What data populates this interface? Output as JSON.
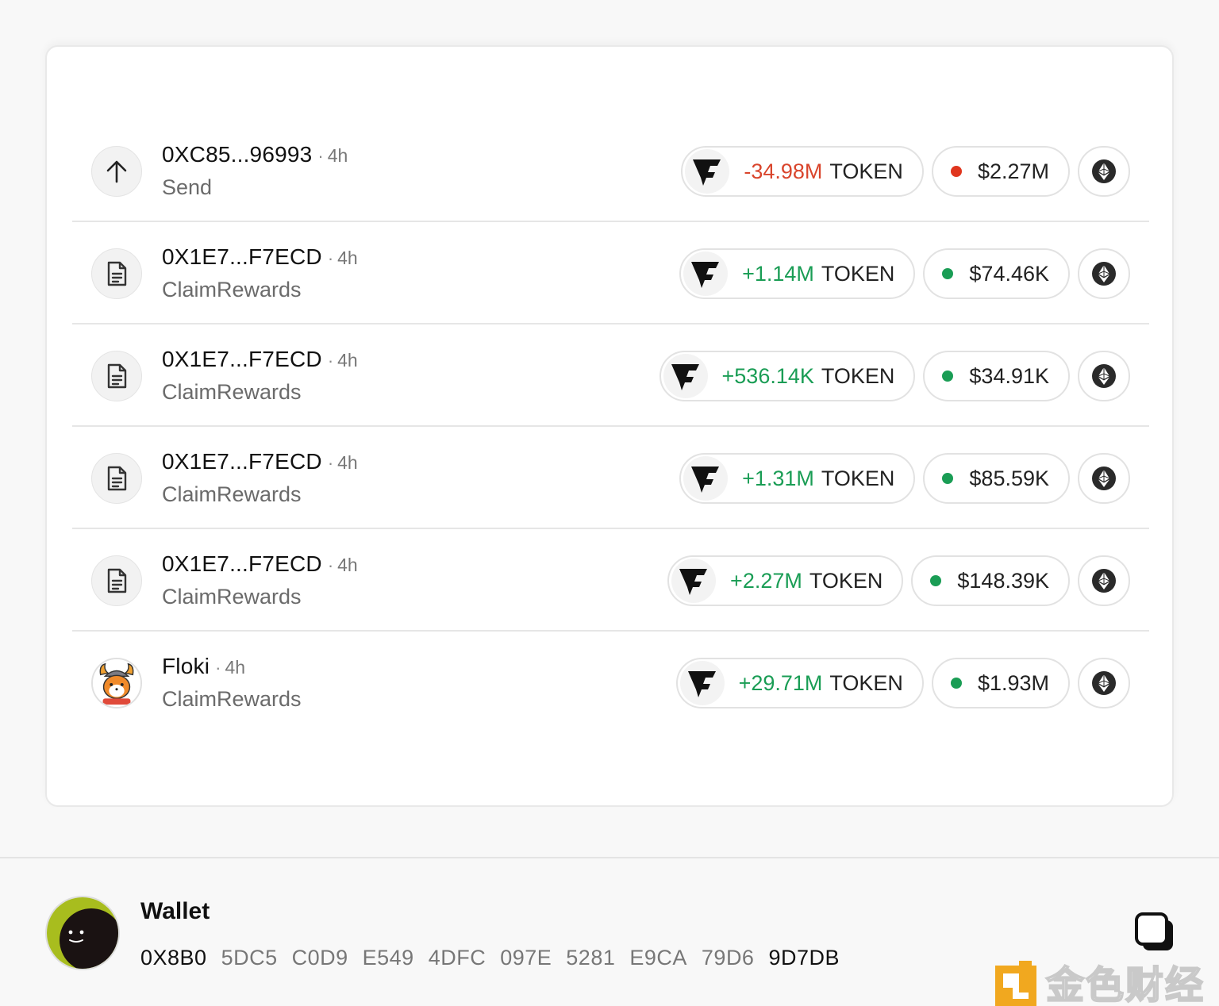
{
  "transactions": [
    {
      "icon": "arrow-up-icon",
      "address": "0XC85...96993",
      "age": "4h",
      "action": "Send",
      "amount": "-34.98M",
      "direction": "negative",
      "token": "TOKEN",
      "usd": "$2.27M",
      "usd_status": "red",
      "chain": "ethereum-icon"
    },
    {
      "icon": "document-icon",
      "address": "0X1E7...F7ECD",
      "age": "4h",
      "action": "ClaimRewards",
      "amount": "+1.14M",
      "direction": "positive",
      "token": "TOKEN",
      "usd": "$74.46K",
      "usd_status": "green",
      "chain": "ethereum-icon"
    },
    {
      "icon": "document-icon",
      "address": "0X1E7...F7ECD",
      "age": "4h",
      "action": "ClaimRewards",
      "amount": "+536.14K",
      "direction": "positive",
      "token": "TOKEN",
      "usd": "$34.91K",
      "usd_status": "green",
      "chain": "ethereum-icon"
    },
    {
      "icon": "document-icon",
      "address": "0X1E7...F7ECD",
      "age": "4h",
      "action": "ClaimRewards",
      "amount": "+1.31M",
      "direction": "positive",
      "token": "TOKEN",
      "usd": "$85.59K",
      "usd_status": "green",
      "chain": "ethereum-icon"
    },
    {
      "icon": "document-icon",
      "address": "0X1E7...F7ECD",
      "age": "4h",
      "action": "ClaimRewards",
      "amount": "+2.27M",
      "direction": "positive",
      "token": "TOKEN",
      "usd": "$148.39K",
      "usd_status": "green",
      "chain": "ethereum-icon"
    },
    {
      "icon": "floki-avatar-icon",
      "address": "Floki",
      "age": "4h",
      "action": "ClaimRewards",
      "amount": "+29.71M",
      "direction": "positive",
      "token": "TOKEN",
      "usd": "$1.93M",
      "usd_status": "green",
      "chain": "ethereum-icon"
    }
  ],
  "colors": {
    "negative": "#d9452c",
    "positive": "#1a9d55"
  },
  "wallet": {
    "title": "Wallet",
    "address_groups": [
      "0X8B0",
      "5DC5",
      "C0D9",
      "E549",
      "4DFC",
      "097E",
      "5281",
      "E9CA",
      "79D6",
      "9D7DB"
    ]
  },
  "watermark": {
    "text": "金色财经"
  }
}
